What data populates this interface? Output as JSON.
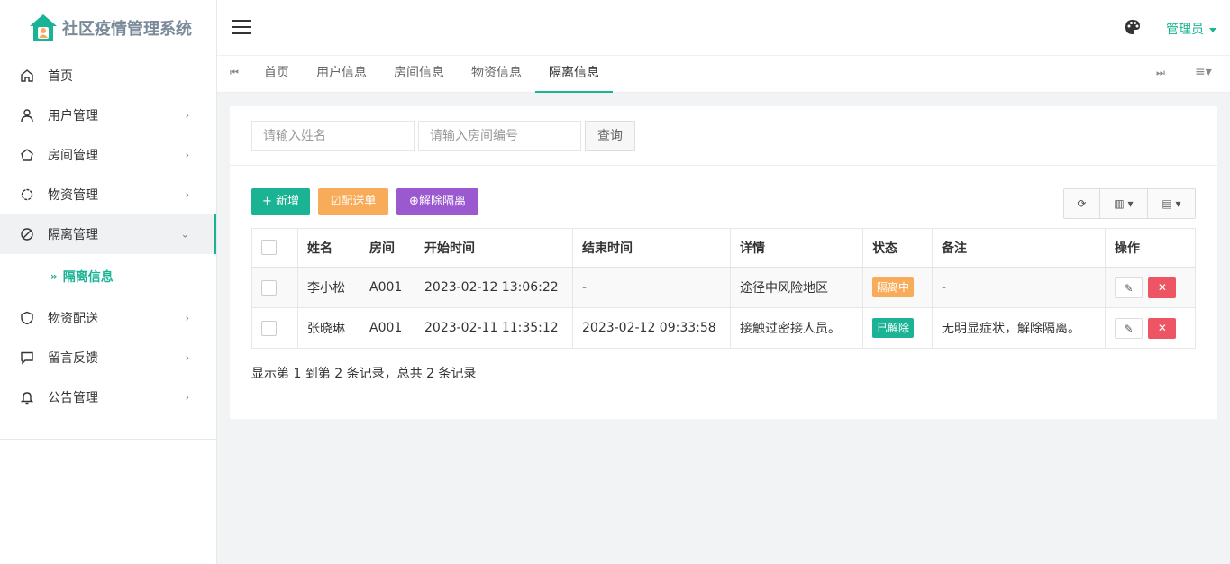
{
  "app": {
    "title": "社区疫情管理系统",
    "accent_color": "#1ab394"
  },
  "sidebar": {
    "items": [
      {
        "label": "首页",
        "icon": "home-icon",
        "has_arrow": false
      },
      {
        "label": "用户管理",
        "icon": "user-icon",
        "has_arrow": true
      },
      {
        "label": "房间管理",
        "icon": "pentagon-icon",
        "has_arrow": true
      },
      {
        "label": "物资管理",
        "icon": "gear-icon",
        "has_arrow": true
      },
      {
        "label": "隔离管理",
        "icon": "ban-icon",
        "has_arrow": true,
        "expanded": true
      },
      {
        "label": "物资配送",
        "icon": "shield-icon",
        "has_arrow": true
      },
      {
        "label": "留言反馈",
        "icon": "message-icon",
        "has_arrow": true
      },
      {
        "label": "公告管理",
        "icon": "bell-icon",
        "has_arrow": true
      }
    ],
    "sub_item": {
      "label": "隔离信息",
      "prefix": "»"
    }
  },
  "header": {
    "user_label": "管理员",
    "palette_icon": "palette-icon"
  },
  "tabs": {
    "items": [
      "首页",
      "用户信息",
      "房间信息",
      "物资信息",
      "隔离信息"
    ],
    "active_index": 4
  },
  "search": {
    "name_placeholder": "请输入姓名",
    "room_placeholder": "请输入房间编号",
    "query_label": "查询"
  },
  "toolbar": {
    "add_label": "新增",
    "dist_label": "配送单",
    "release_label": "解除隔离"
  },
  "table": {
    "columns": [
      "姓名",
      "房间",
      "开始时间",
      "结束时间",
      "详情",
      "状态",
      "备注",
      "操作"
    ],
    "rows": [
      {
        "name": "李小松",
        "room": "A001",
        "start": "2023-02-12 13:06:22",
        "end": "-",
        "detail": "途径中风险地区",
        "status": "隔离中",
        "status_color": "#f8ac59",
        "note": "-"
      },
      {
        "name": "张晓琳",
        "room": "A001",
        "start": "2023-02-11 11:35:12",
        "end": "2023-02-12 09:33:58",
        "detail": "接触过密接人员。",
        "status": "已解除",
        "status_color": "#1ab394",
        "note": "无明显症状，解除隔离。"
      }
    ]
  },
  "pager": {
    "text": "显示第 1 到第 2 条记录，总共 2 条记录"
  }
}
